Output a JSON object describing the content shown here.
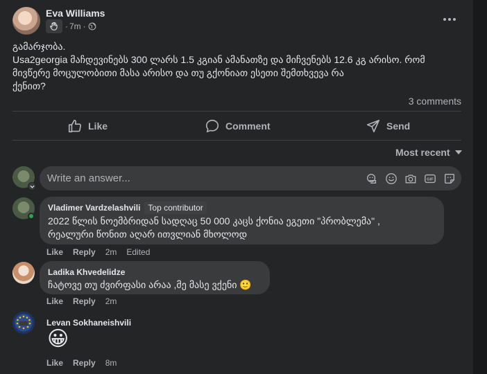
{
  "post": {
    "author": "Eva Williams",
    "time": "7m",
    "meta_sep1": "·",
    "meta_sep2": "·",
    "body_lines": [
      "გამარჯობა.",
      "Usa2georgia მაჩდევინებს 300 ლარს 1.5 კგიან ამანათზე და მიჩვენებს 12.6 კგ არისო. რომ",
      "მივწერე მოცულობითი მასა არისო და თუ გქონიათ ესეთი შემთხვევა რა",
      "ქენით?"
    ],
    "comment_count": "3 comments"
  },
  "actions": {
    "like": "Like",
    "comment": "Comment",
    "send": "Send"
  },
  "sort": {
    "label": "Most recent"
  },
  "composer": {
    "placeholder": "Write an answer..."
  },
  "comments": [
    {
      "author": "Vladimer Vardzelashvili",
      "badge": "Top contributor",
      "lines": [
        "2022 წლის ნოემბრიდან სადღაც 50 000 კაცს ქონია ეგეთი \"პრობლემა\" ,",
        "რეალური წონით აღარ ითვლიან მხოლოდ"
      ],
      "like": "Like",
      "reply": "Reply",
      "time": "2m",
      "edited": "Edited"
    },
    {
      "author": "Ladika Khvedelidze",
      "lines": [
        "ჩატოვე თუ ძვირფასი არაა ,მე მასე ვქენი"
      ],
      "emoji": "🙂",
      "like": "Like",
      "reply": "Reply",
      "time": "2m"
    },
    {
      "author": "Levan Sokhaneishvili",
      "emoji": "😀",
      "like": "Like",
      "reply": "Reply",
      "time": "8m"
    }
  ],
  "colors": {
    "background": "#242526",
    "bubble": "#3a3b3c",
    "text": "#e4e6eb",
    "secondary": "#b0b3b8",
    "online": "#31a24c"
  }
}
